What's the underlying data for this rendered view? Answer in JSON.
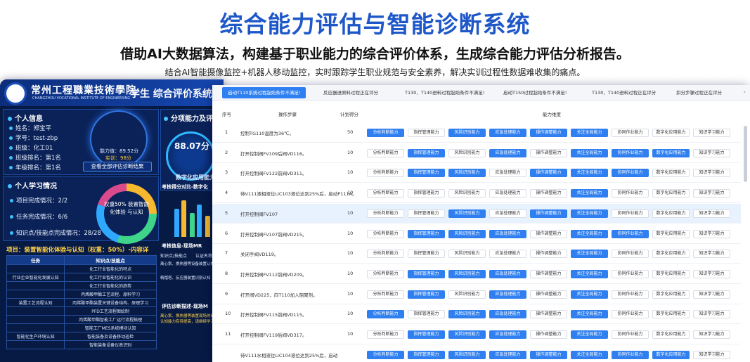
{
  "header": {
    "title": "综合能力评估与智能诊断系统",
    "subtitle": "借助AI大数据算法，构建基于职业能力的综合评价体系，生成综合能力评估分析报告。",
    "caption": "结合AI智能摄像监控+机器人移动监控，实时跟踪学生职业规范与安全素养，解决实训过程性数据难收集的痛点。"
  },
  "dashboard": {
    "school_name": "常州工程職業技術學院",
    "school_name_en": "CHANGZHOU VOCATIONAL INSTITUTE OF ENGINEERING",
    "system_title": "学生 综合评价系统 -",
    "personal_info": {
      "title": "个人信息",
      "items": [
        "姓名：郑宝平",
        "学号：test-zbp",
        "班级：化工01",
        "班级排名：第1名",
        "年级排名：第1名"
      ]
    },
    "ability_label": "能力值：89.52分",
    "ability_sub": "实训：98分",
    "view_all_button": "查看全部评估诊断结果",
    "ability_panel_title": "分项能力及评估",
    "score": "88.07分",
    "digital_label": "数字化应用能力",
    "learning": {
      "title": "个人学习情况",
      "items": [
        "项目完成情况：2/2",
        "任务完成情况：6/6",
        "知识点/技能点完成情况：28/28"
      ]
    },
    "donut_text": "权重50%\n装置智能化体验\n与认知",
    "compare_title": "考核得分对比-数字化",
    "eval_title": "考核信息-现场MR",
    "diag_title": "评估诊断描述-现场M",
    "task_title": "项目：装置智能化体验与认知（权重：50%）-内容详",
    "task_table": {
      "headers": [
        "任务",
        "知识点/技能点"
      ],
      "rows": [
        [
          "",
          "化工行业智能化的特点"
        ],
        [
          "行业企业智能化发展认知",
          "化工行业智能化的认识"
        ],
        [
          "",
          "化工行业智能化的趋势"
        ],
        [
          "",
          "丙烯酸甲酯工艺流程、原料学习"
        ],
        [
          "装置工艺流程认知",
          "丙烯酸甲酯装置关键设备结构、原理学习"
        ],
        [
          "",
          "PFD工艺流程图绘制"
        ],
        [
          "",
          "丙烯酸甲酯智能工厂运行流程梳理"
        ],
        [
          "",
          "智能工厂MES系统模块认知"
        ],
        [
          "智能化生产环境认知",
          "智能装备及设备移动巡检"
        ],
        [
          "",
          "智能装备设备仪表识别"
        ]
      ]
    },
    "mr_table": [
      "知识点/技能点",
      "认证名称",
      "离心泵、换热器等设备装置认知",
      "精馏塔、反应器装置识别认知"
    ],
    "diag_text": "离心泵、换热器等装置现场的确认与认知能力有待提高，请继续学习。"
  },
  "table": {
    "tabs": [
      "启动T110系统过程起始条件不满足!",
      "反应器进原料过程正在评分",
      "T130、T140进料过程起始条件不满足!",
      "启动T150过程起始条件不满足!",
      "T130、T140进料过程正在评分",
      "扣分步骤过程正在评分"
    ],
    "headers": {
      "index": "序号",
      "step": "操作步骤",
      "score": "计划得分",
      "dimension": "能力维度"
    },
    "abilities": [
      "分析判断能力",
      "指挥管理能力",
      "风险识别能力",
      "应急处理能力",
      "操作调整能力",
      "关注全局能力",
      "协同作业能力",
      "数字化应用能力",
      "知识学习能力"
    ],
    "rows": [
      {
        "index": "1",
        "step": "控制TG110温度为36℃。",
        "score": "50"
      },
      {
        "index": "2",
        "step": "打开控制阀FV109后阀VD116。",
        "score": "10"
      },
      {
        "index": "3",
        "step": "打开控制阀FV122前阀VD311。",
        "score": "10"
      },
      {
        "index": "4",
        "step": "待V111液相液位LIC103液位达到25%后，启动P111A。",
        "score": "10"
      },
      {
        "index": "5",
        "step": "打开控制阀FV107",
        "score": "10"
      },
      {
        "index": "6",
        "step": "打开控制阀FV107前阀VD215。",
        "score": "10"
      },
      {
        "index": "7",
        "step": "关闭手阀VD119。",
        "score": "10"
      },
      {
        "index": "8",
        "step": "打开控制阀FV112前阀VD209。",
        "score": "10"
      },
      {
        "index": "9",
        "step": "打开阀VD225，向T110加入阻聚剂。",
        "score": "10"
      },
      {
        "index": "10",
        "step": "打开控制阀FV115前阀VD115。",
        "score": "10"
      },
      {
        "index": "11",
        "step": "打开控制阀FV119后阀VD317。",
        "score": "10"
      },
      {
        "index": "",
        "step": "待V111水相液位LIC104液位达到25%后，启动",
        "score": ""
      }
    ],
    "highlight_matrix": [
      [
        1,
        0,
        1,
        1,
        1,
        1,
        0,
        0,
        0
      ],
      [
        0,
        1,
        0,
        1,
        0,
        1,
        1,
        1,
        0
      ],
      [
        0,
        1,
        1,
        0,
        1,
        1,
        1,
        0,
        0
      ],
      [
        0,
        0,
        0,
        0,
        0,
        1,
        0,
        0,
        0
      ],
      [
        0,
        0,
        1,
        0,
        1,
        1,
        0,
        0,
        0
      ],
      [
        0,
        1,
        1,
        1,
        0,
        1,
        1,
        0,
        0
      ],
      [
        0,
        0,
        0,
        0,
        0,
        1,
        0,
        0,
        0
      ],
      [
        0,
        1,
        1,
        1,
        0,
        1,
        0,
        0,
        0
      ],
      [
        0,
        1,
        0,
        1,
        0,
        1,
        0,
        0,
        0
      ],
      [
        1,
        0,
        1,
        1,
        0,
        1,
        0,
        0,
        0
      ],
      [
        0,
        1,
        1,
        1,
        0,
        1,
        0,
        0,
        0
      ],
      [
        1,
        1,
        1,
        1,
        1,
        1,
        1,
        1,
        0
      ]
    ]
  }
}
